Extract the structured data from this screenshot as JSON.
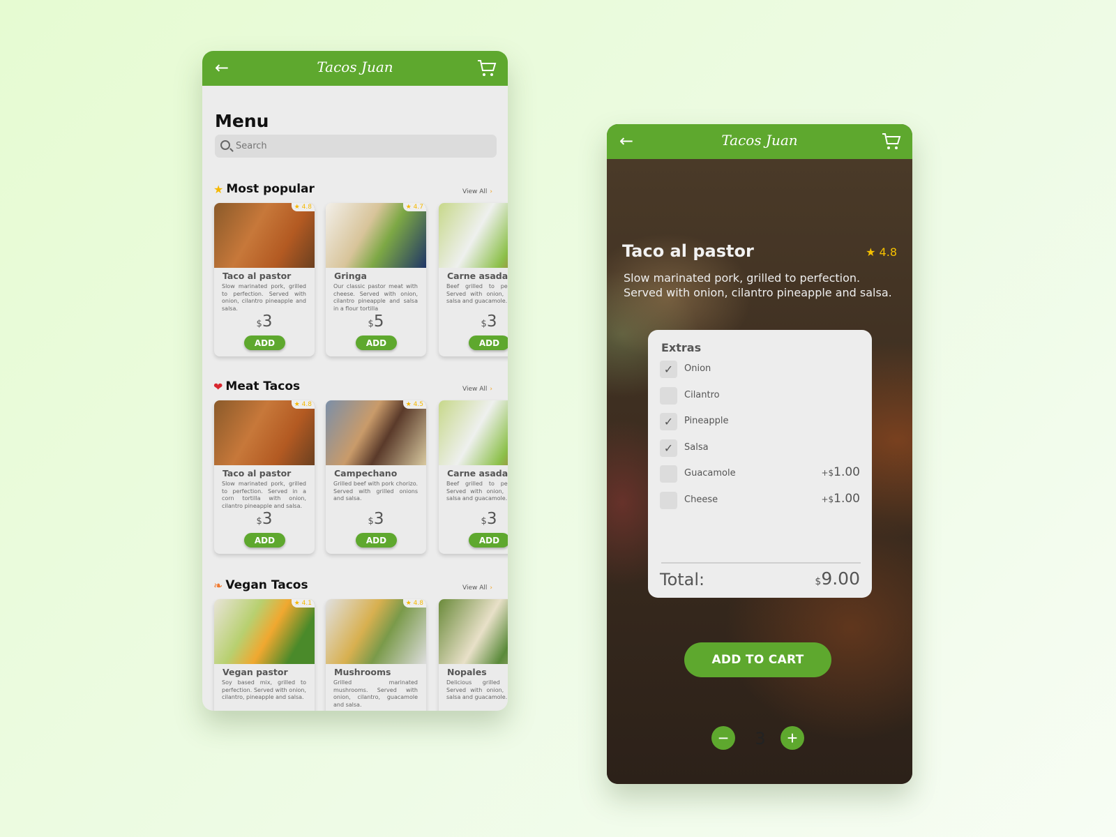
{
  "colors": {
    "brand": "#5ea82e",
    "star": "#f5b800",
    "background": "#e6fbd2"
  },
  "app": {
    "title": "Tacos Juan",
    "back_icon": "arrow-left-icon",
    "cart_icon": "cart-icon"
  },
  "menu": {
    "title": "Menu",
    "search_placeholder": "Search",
    "view_all": "View All",
    "add_label": "ADD",
    "sections": [
      {
        "title": "Most popular",
        "icon": "star-icon",
        "items": [
          {
            "name": "Taco al pastor",
            "rating": "4.8",
            "desc": "Slow marinated pork, grilled to perfection. Served with onion, cilantro pineapple and salsa.",
            "price": "3"
          },
          {
            "name": "Gringa",
            "rating": "4.7",
            "desc": "Our classic pastor meat with cheese. Served with onion, cilantro pineapple and salsa in a flour tortilla",
            "price": "5"
          },
          {
            "name": "Carne asada",
            "rating": "",
            "desc": "Beef grilled to perfection. Served with onion, cilantro, salsa and guacamole.",
            "price": "3"
          }
        ]
      },
      {
        "title": "Meat Tacos",
        "icon": "steak-icon",
        "items": [
          {
            "name": "Taco al pastor",
            "rating": "4.8",
            "desc": "Slow marinated pork, grilled to perfection. Served in a corn tortilla with onion, cilantro pineapple and salsa.",
            "price": "3"
          },
          {
            "name": "Campechano",
            "rating": "4.5",
            "desc": "Grilled beef with pork chorizo. Served with grilled onions and salsa.",
            "price": "3"
          },
          {
            "name": "Carne asada",
            "rating": "",
            "desc": "Beef grilled to perfection. Served with onion, cilantro, salsa and guacamole.",
            "price": "3"
          }
        ]
      },
      {
        "title": "Vegan Tacos",
        "icon": "carrot-icon",
        "items": [
          {
            "name": "Vegan pastor",
            "rating": "4.1",
            "desc": "Soy based mix, grilled to perfection. Served with onion, cilantro, pineapple and salsa.",
            "price": ""
          },
          {
            "name": "Mushrooms",
            "rating": "4.8",
            "desc": "Grilled marinated mushrooms. Served with onion, cilantro, guacamole and salsa.",
            "price": ""
          },
          {
            "name": "Nopales",
            "rating": "",
            "desc": "Delicious grilled cactus. Served with onion, cilantro, salsa and guacamole.",
            "price": ""
          }
        ]
      }
    ]
  },
  "detail": {
    "title": "Taco al pastor",
    "rating": "4.8",
    "desc": "Slow marinated pork, grilled to perfection. Served with onion, cilantro pineapple and salsa.",
    "extras_title": "Extras",
    "extras": [
      {
        "label": "Onion",
        "checked": true,
        "price": ""
      },
      {
        "label": "Cilantro",
        "checked": false,
        "price": ""
      },
      {
        "label": "Pineapple",
        "checked": true,
        "price": ""
      },
      {
        "label": "Salsa",
        "checked": true,
        "price": ""
      },
      {
        "label": "Guacamole",
        "checked": false,
        "price": "1.00"
      },
      {
        "label": "Cheese",
        "checked": false,
        "price": "1.00"
      }
    ],
    "quantity": "3",
    "total_label": "Total:",
    "total": "9.00",
    "add_to_cart": "ADD TO CART"
  }
}
